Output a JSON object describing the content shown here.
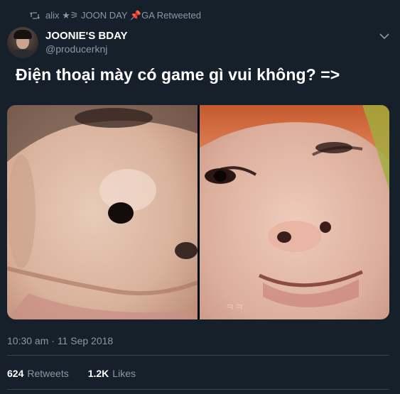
{
  "retweet_banner": {
    "icon": "retweet-icon",
    "text": "alix ★⚞ JOON DAY 📌GA Retweeted"
  },
  "author": {
    "display_name": "JOONIE'S BDAY",
    "handle": "@producerknj",
    "avatar_icon": "avatar"
  },
  "tweet": {
    "text": "Điện thoại mày có game gì vui không? =>",
    "media_icons": [
      "face-closeup-photo-left",
      "face-closeup-photo-right"
    ]
  },
  "meta": {
    "timestamp": "10:30 am · 11 Sep 2018"
  },
  "stats": {
    "retweets_count": "624",
    "retweets_label": "Retweets",
    "likes_count": "1.2K",
    "likes_label": "Likes"
  },
  "colors": {
    "background": "#15202b",
    "secondary_text": "#8899a6",
    "primary_text": "#ffffff",
    "divider": "#38444d"
  }
}
